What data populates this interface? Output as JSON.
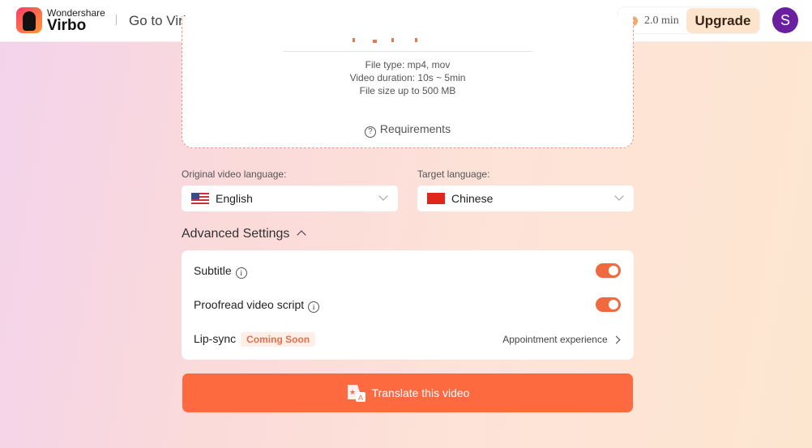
{
  "header": {
    "brand_small": "Wondershare",
    "brand_large": "Virbo",
    "goto_label": "Go to Virbo",
    "goto_chevron": "›",
    "credits": "2.0 min",
    "upgrade_label": "Upgrade",
    "avatar_initial": "S"
  },
  "upload": {
    "file_type": "File type: mp4, mov",
    "duration": "Video duration: 10s ~ 5min",
    "size": "File size up to 500 MB",
    "requirements_label": "Requirements",
    "accent": "#e49a7c"
  },
  "languages": {
    "original_label": "Original video language:",
    "original_value": "English",
    "target_label": "Target language:",
    "target_value": "Chinese"
  },
  "advanced": {
    "title": "Advanced Settings",
    "subtitle_label": "Subtitle",
    "subtitle_on": true,
    "proofread_label": "Proofread video script",
    "proofread_on": true,
    "lipsync_label": "Lip-sync",
    "lipsync_badge": "Coming Soon",
    "appointment_label": "Appointment experience"
  },
  "action": {
    "translate_label": "Translate this video",
    "color": "#fe6a3f"
  }
}
